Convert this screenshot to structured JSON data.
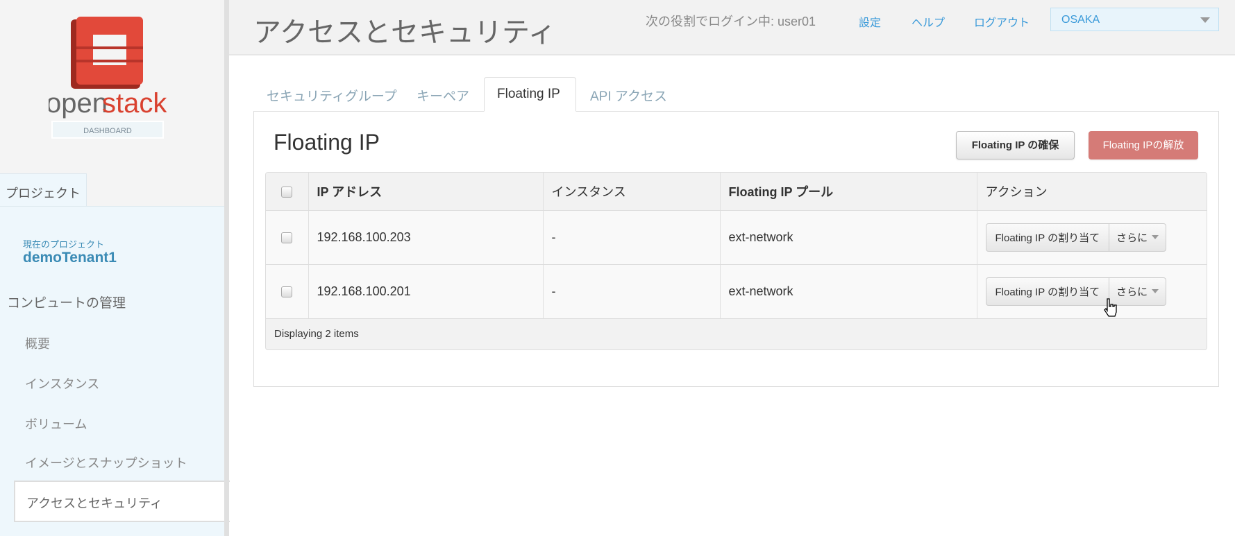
{
  "logo": {
    "word_open": "open",
    "word_stack": "stack",
    "subtitle": "DASHBOARD"
  },
  "sidebar": {
    "project_tab": "プロジェクト",
    "current_project_label": "現在のプロジェクト",
    "current_project": "demoTenant1",
    "section": "コンピュートの管理",
    "items": [
      {
        "label": "概要"
      },
      {
        "label": "インスタンス"
      },
      {
        "label": "ボリューム"
      },
      {
        "label": "イメージとスナップショット"
      },
      {
        "label": "アクセスとセキュリティ",
        "active": true
      }
    ]
  },
  "header": {
    "title": "アクセスとセキュリティ",
    "user_text": "次の役割でログイン中: user01",
    "settings": "設定",
    "help": "ヘルプ",
    "logout": "ログアウト",
    "region": "OSAKA"
  },
  "tabs": [
    {
      "label": "セキュリティグループ"
    },
    {
      "label": "キーペア"
    },
    {
      "label": "Floating IP",
      "active": true
    },
    {
      "label": "API アクセス"
    }
  ],
  "panel": {
    "title": "Floating IP",
    "allocate_button": "Floating IP の確保",
    "release_button": "Floating IPの解放"
  },
  "table": {
    "headers": [
      "IP アドレス",
      "インスタンス",
      "Floating IP プール",
      "アクション"
    ],
    "rows": [
      {
        "ip": "192.168.100.203",
        "instance": "-",
        "pool": "ext-network",
        "action": "Floating IP の割り当て",
        "more": "さらに"
      },
      {
        "ip": "192.168.100.201",
        "instance": "-",
        "pool": "ext-network",
        "action": "Floating IP の割り当て",
        "more": "さらに"
      }
    ],
    "footer": "Displaying 2 items"
  },
  "colors": {
    "accent": "#3a9ad9",
    "danger": "#d57b77",
    "logo_red": "#d9412f"
  }
}
